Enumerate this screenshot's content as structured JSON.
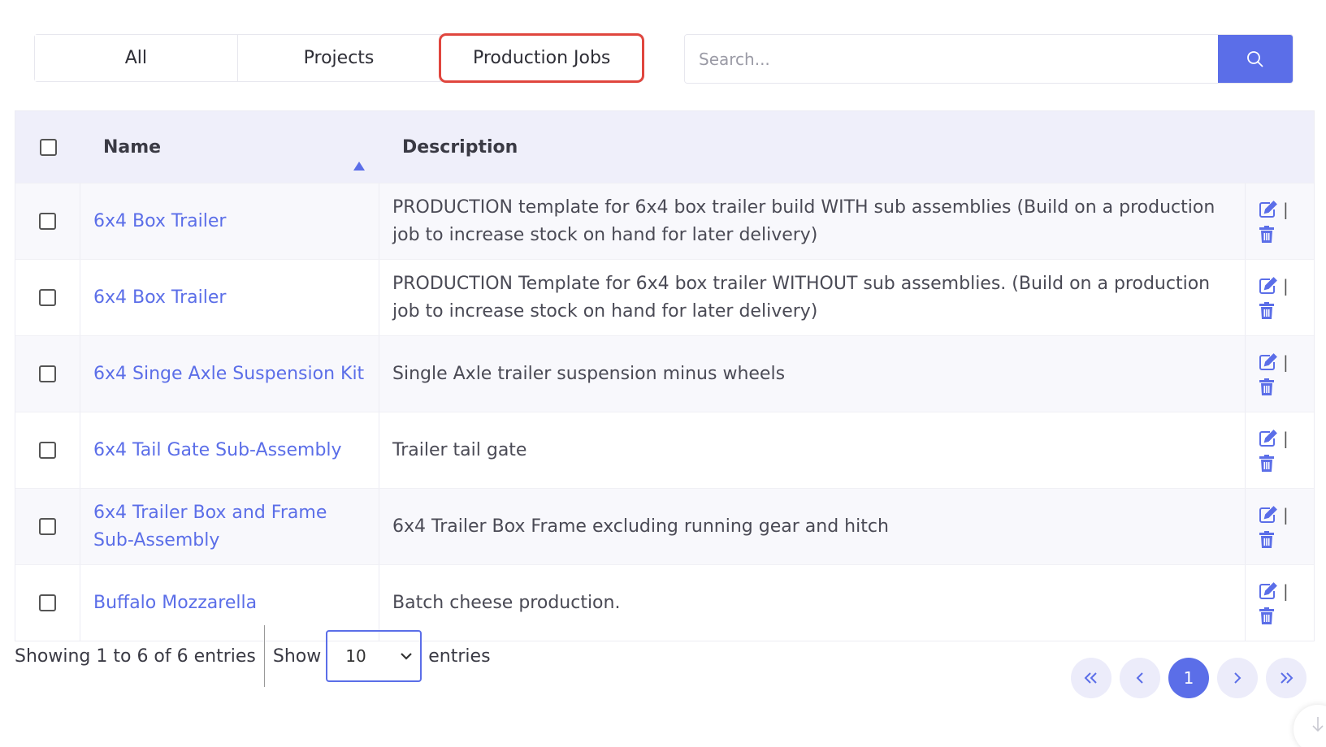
{
  "tabs": [
    {
      "label": "All"
    },
    {
      "label": "Projects"
    },
    {
      "label": "Production Jobs"
    }
  ],
  "active_tab": "Production Jobs",
  "search": {
    "placeholder": "Search..."
  },
  "table": {
    "headers": {
      "name": "Name",
      "description": "Description"
    },
    "rows": [
      {
        "name": "6x4 Box Trailer",
        "description": "PRODUCTION template for 6x4 box trailer build WITH sub assemblies (Build on a production job to increase stock on hand for later delivery)"
      },
      {
        "name": "6x4 Box Trailer",
        "description": "PRODUCTION Template for 6x4 box trailer WITHOUT sub assemblies. (Build on a production job to increase stock on hand for later delivery)"
      },
      {
        "name": "6x4 Singe Axle Suspension Kit",
        "description": "Single Axle trailer suspension minus wheels"
      },
      {
        "name": "6x4 Tail Gate Sub-Assembly",
        "description": "Trailer tail gate"
      },
      {
        "name": "6x4 Trailer Box and Frame Sub-Assembly",
        "description": "6x4 Trailer Box Frame excluding running gear and hitch"
      },
      {
        "name": "Buffalo Mozzarella",
        "description": "Batch cheese production."
      }
    ],
    "action_separator": "|"
  },
  "footer": {
    "showing": "Showing 1 to 6 of 6 entries",
    "show_label": "Show",
    "page_size": "10",
    "entries_label": "entries"
  },
  "pagination": {
    "current_page": "1"
  },
  "colors": {
    "accent": "#5b6ee8",
    "active_tab_outline": "#e0463e",
    "header_bg": "#efeffa"
  }
}
